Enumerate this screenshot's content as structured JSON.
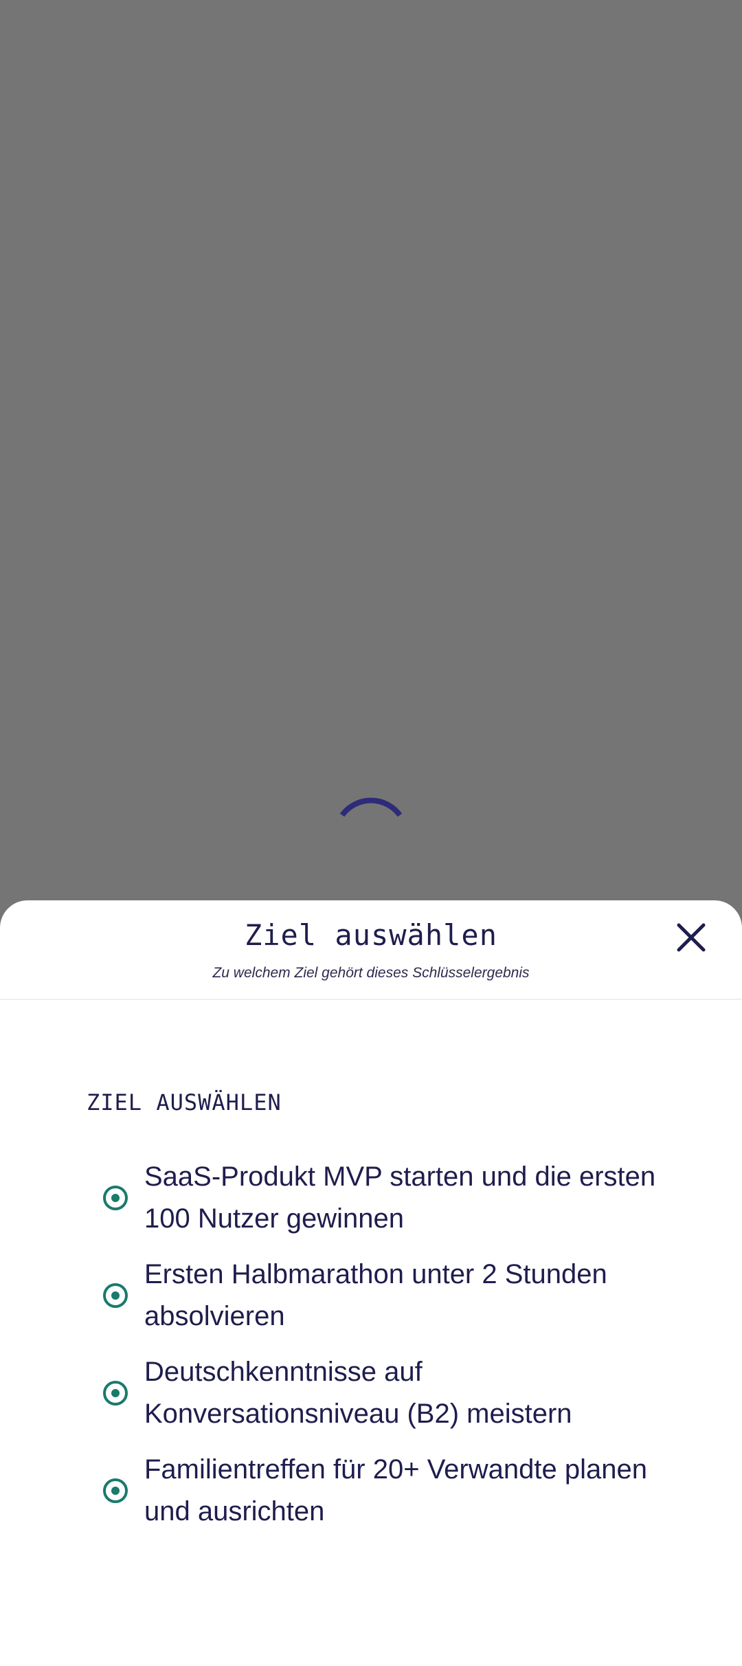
{
  "dialog": {
    "title": "Ziel auswählen",
    "subtitle": "Zu welchem Ziel gehört dieses Schlüsselergebnis",
    "close_icon": "close-icon"
  },
  "section": {
    "label": "ZIEL AUSWÄHLEN"
  },
  "goals": [
    {
      "label": "SaaS-Produkt MVP starten und die ersten 100 Nutzer gewinnen"
    },
    {
      "label": "Ersten Halbmarathon unter 2 Stunden absolvieren"
    },
    {
      "label": "Deutschkenntnisse auf Konversationsniveau (B2) meistern"
    },
    {
      "label": "Familientreffen für 20+ Verwandte planen und ausrichten"
    }
  ],
  "colors": {
    "scrim": "#757575",
    "sheet": "#ffffff",
    "text": "#1f1d4d",
    "radio": "#1a7a6c",
    "spinner": "#2e2c78"
  }
}
